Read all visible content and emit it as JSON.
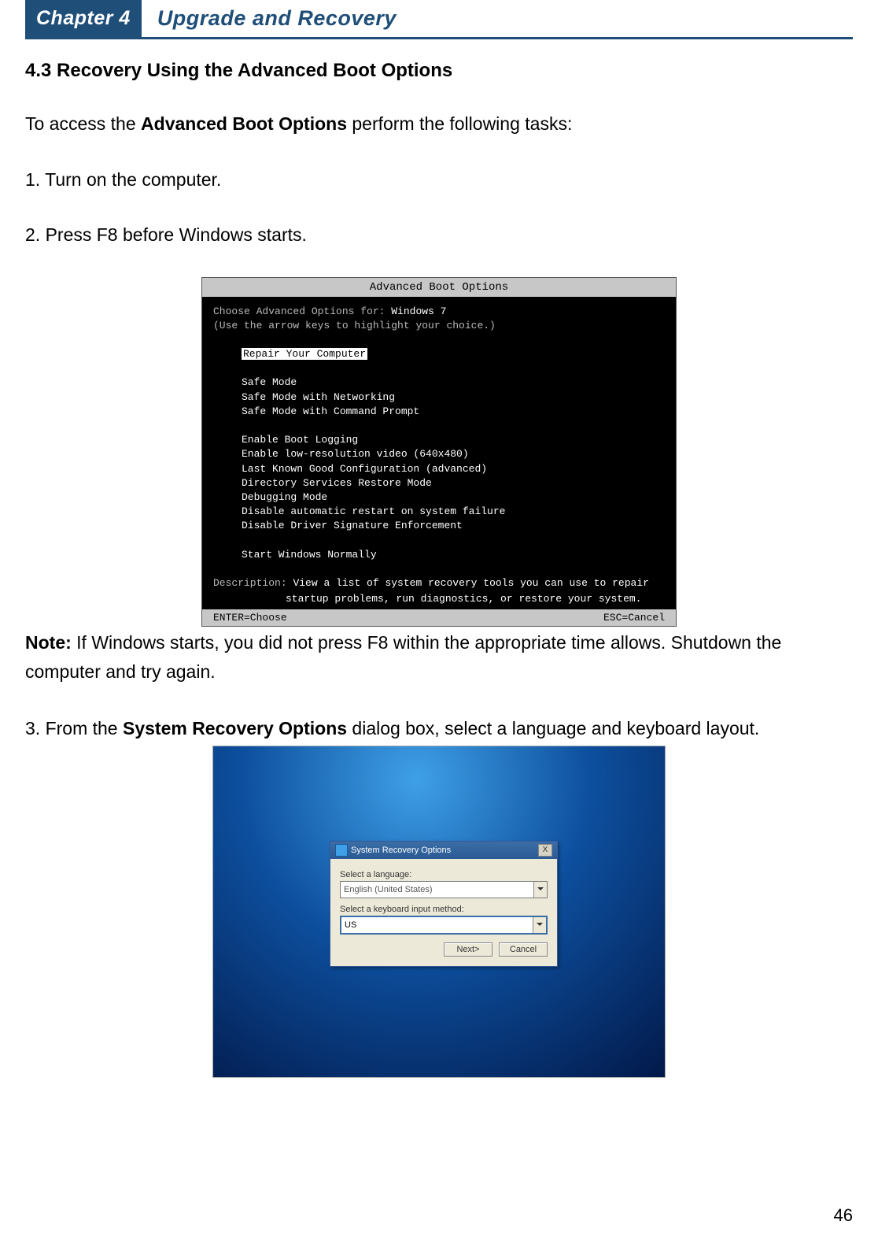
{
  "chapter": {
    "badge": "Chapter 4",
    "title": "Upgrade and Recovery"
  },
  "section_heading": "4.3 Recovery Using the Advanced Boot Options",
  "intro": {
    "pre": "To access the ",
    "bold": "Advanced Boot Options",
    "post": " perform the following tasks:"
  },
  "steps": {
    "s1": "1. Turn on the computer.",
    "s2": "2. Press F8 before Windows starts.",
    "s3": {
      "pre": "3. From the ",
      "bold": "System Recovery Options",
      "post": " dialog box, select a language and keyboard layout."
    }
  },
  "fig1": {
    "title": "Advanced Boot Options",
    "choose_pre": "Choose Advanced Options for: ",
    "choose_os": "Windows 7",
    "arrows": "(Use the arrow keys to highlight your choice.)",
    "selected": "Repair Your Computer",
    "opts": {
      "o1": "Safe Mode",
      "o2": "Safe Mode with Networking",
      "o3": "Safe Mode with Command Prompt",
      "o4": "Enable Boot Logging",
      "o5": "Enable low-resolution video (640x480)",
      "o6": "Last Known Good Configuration (advanced)",
      "o7": "Directory Services Restore Mode",
      "o8": "Debugging Mode",
      "o9": "Disable automatic restart on system failure",
      "o10": "Disable Driver Signature Enforcement",
      "o11": "Start Windows Normally"
    },
    "desc_label": "Description:",
    "desc_l1": "View a list of system recovery tools you can use to repair",
    "desc_l2": "startup problems, run diagnostics, or restore your system.",
    "footer": {
      "enter": "ENTER=Choose",
      "esc": "ESC=Cancel"
    }
  },
  "note": {
    "label": "Note:",
    "text": " If Windows starts, you did not press F8 within the appropriate time allows. Shutdown the computer and try again."
  },
  "fig2": {
    "title": "System Recovery Options",
    "lang_label": "Select a language:",
    "lang_value": "English (United States)",
    "kbd_label": "Select a keyboard input method:",
    "kbd_value": "US",
    "btn_next": "Next>",
    "btn_cancel": "Cancel",
    "close": "X"
  },
  "page_number": "46"
}
